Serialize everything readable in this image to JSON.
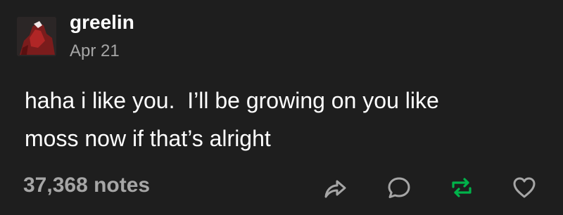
{
  "post": {
    "username": "greelin",
    "date": "Apr 21",
    "body": "haha i like you.  I’ll be growing on you like\nmoss now if that’s alright",
    "notes": "37,368 notes"
  },
  "actions": {
    "share_icon": "share-icon",
    "reply_icon": "reply-icon",
    "reblog_icon": "reblog-icon",
    "like_icon": "heart-icon"
  },
  "colors": {
    "background": "#1e1e1e",
    "text": "#ffffff",
    "muted": "#a6a6a6",
    "reblog_active": "#00b34a"
  }
}
